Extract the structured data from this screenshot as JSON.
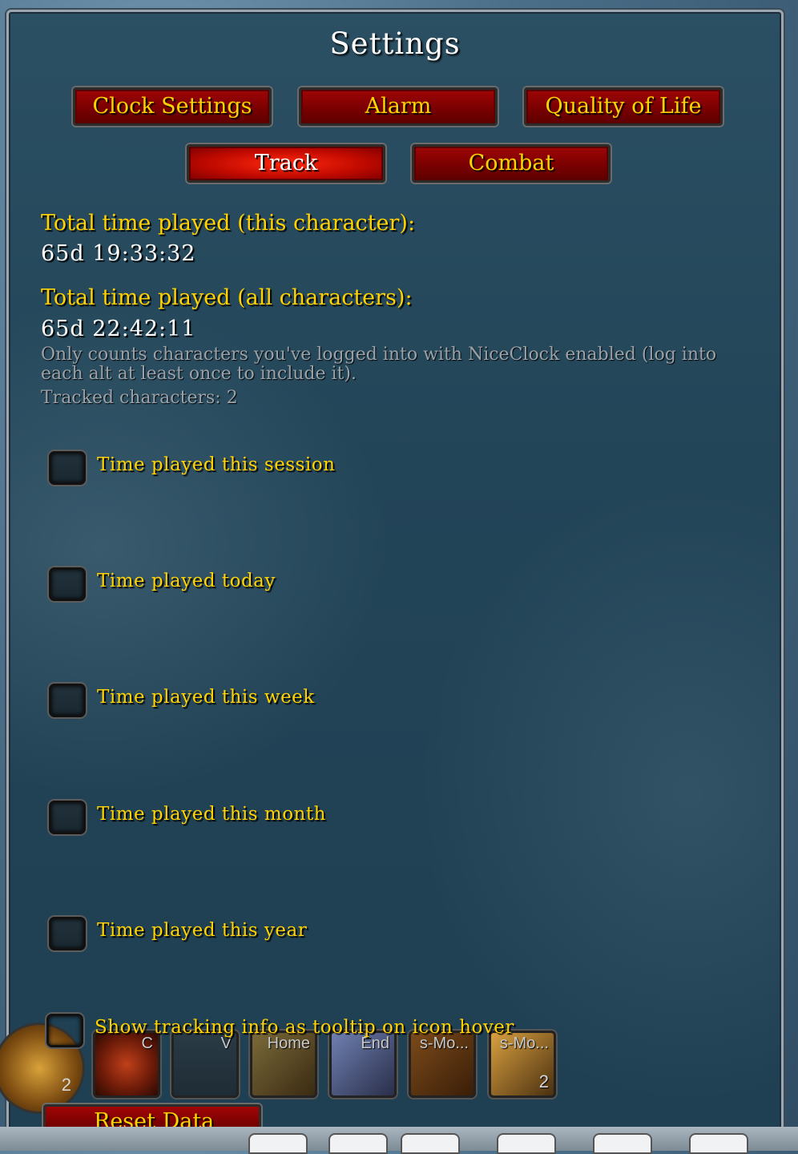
{
  "window": {
    "title": "Settings"
  },
  "tabs": [
    {
      "label": "Clock Settings",
      "active": false
    },
    {
      "label": "Alarm",
      "active": false
    },
    {
      "label": "Quality of Life",
      "active": false
    },
    {
      "label": "Track",
      "active": true
    },
    {
      "label": "Combat",
      "active": false
    }
  ],
  "stats": {
    "this_character_label": "Total time played (this character):",
    "this_character_value": "65d 19:33:32",
    "all_characters_label": "Total time played (all characters):",
    "all_characters_value": "65d 22:42:11",
    "note": "Only counts characters you've logged into with NiceClock enabled (log into each alt at least once to include it).",
    "tracked": "Tracked characters: 2"
  },
  "options": [
    {
      "label": "Time played this session",
      "checked": false
    },
    {
      "label": "Time played today",
      "checked": false
    },
    {
      "label": "Time played this week",
      "checked": false
    },
    {
      "label": "Time played this month",
      "checked": false
    },
    {
      "label": "Time played this year",
      "checked": false
    },
    {
      "label": "Show tracking info as tooltip on icon hover",
      "checked": false
    }
  ],
  "reset_button": "Reset Data",
  "actionbar": {
    "slots": [
      {
        "key": "C",
        "count": ""
      },
      {
        "key": "V",
        "count": ""
      },
      {
        "key": "Home",
        "count": ""
      },
      {
        "key": "End",
        "count": ""
      },
      {
        "key": "s-Mo...",
        "count": ""
      },
      {
        "key": "s-Mo...",
        "count": "2"
      }
    ],
    "first_slot_count": "2"
  }
}
